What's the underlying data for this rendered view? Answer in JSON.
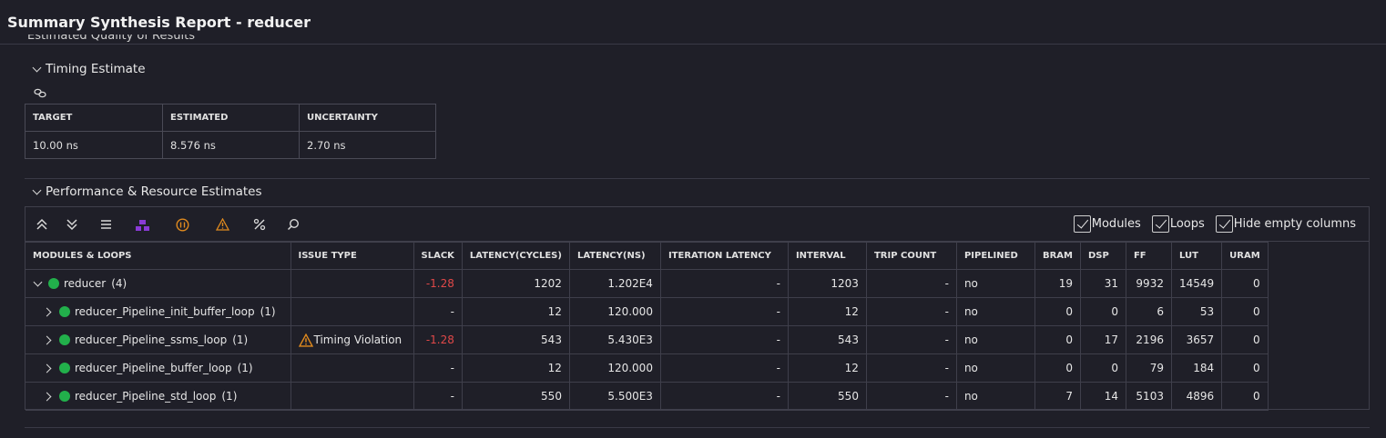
{
  "window": {
    "title": "Summary Synthesis Report - reducer"
  },
  "clipped_section": {
    "title": "Estimated Quality of Results"
  },
  "timing": {
    "title": "Timing Estimate",
    "headers": [
      "TARGET",
      "ESTIMATED",
      "UNCERTAINTY"
    ],
    "values": [
      "10.00 ns",
      "8.576 ns",
      "2.70 ns"
    ]
  },
  "perf": {
    "title": "Performance & Resource Estimates",
    "toolbar": {
      "icons": [
        "collapse-all-icon",
        "expand-all-icon",
        "list-icon",
        "module-hierarchy-icon",
        "pipeline-icon",
        "warning-icon",
        "percent-icon",
        "search-icon"
      ],
      "checkboxes": [
        {
          "label": "Modules",
          "checked": true
        },
        {
          "label": "Loops",
          "checked": true
        },
        {
          "label": "Hide empty columns",
          "checked": true
        }
      ]
    },
    "headers": [
      "MODULES & LOOPS",
      "ISSUE TYPE",
      "SLACK",
      "LATENCY(CYCLES)",
      "LATENCY(NS)",
      "ITERATION LATENCY",
      "INTERVAL",
      "TRIP COUNT",
      "PIPELINED",
      "BRAM",
      "DSP",
      "FF",
      "LUT",
      "URAM"
    ],
    "rows": [
      {
        "name": "reducer",
        "count": "(4)",
        "issue": "",
        "slack": "-1.28",
        "lat_cycles": "1202",
        "lat_ns": "1.202E4",
        "iter_lat": "-",
        "interval": "1203",
        "trip": "-",
        "pipelined": "no",
        "bram": "19",
        "dsp": "31",
        "ff": "9932",
        "lut": "14549",
        "uram": "0"
      },
      {
        "name": "reducer_Pipeline_init_buffer_loop",
        "count": "(1)",
        "issue": "",
        "slack": "-",
        "lat_cycles": "12",
        "lat_ns": "120.000",
        "iter_lat": "-",
        "interval": "12",
        "trip": "-",
        "pipelined": "no",
        "bram": "0",
        "dsp": "0",
        "ff": "6",
        "lut": "53",
        "uram": "0"
      },
      {
        "name": "reducer_Pipeline_ssms_loop",
        "count": "(1)",
        "issue": "Timing Violation",
        "slack": "-1.28",
        "lat_cycles": "543",
        "lat_ns": "5.430E3",
        "iter_lat": "-",
        "interval": "543",
        "trip": "-",
        "pipelined": "no",
        "bram": "0",
        "dsp": "17",
        "ff": "2196",
        "lut": "3657",
        "uram": "0"
      },
      {
        "name": "reducer_Pipeline_buffer_loop",
        "count": "(1)",
        "issue": "",
        "slack": "-",
        "lat_cycles": "12",
        "lat_ns": "120.000",
        "iter_lat": "-",
        "interval": "12",
        "trip": "-",
        "pipelined": "no",
        "bram": "0",
        "dsp": "0",
        "ff": "79",
        "lut": "184",
        "uram": "0"
      },
      {
        "name": "reducer_Pipeline_std_loop",
        "count": "(1)",
        "issue": "",
        "slack": "-",
        "lat_cycles": "550",
        "lat_ns": "5.500E3",
        "iter_lat": "-",
        "interval": "550",
        "trip": "-",
        "pipelined": "no",
        "bram": "7",
        "dsp": "14",
        "ff": "5103",
        "lut": "4896",
        "uram": "0"
      }
    ]
  },
  "colors": {
    "background": "#1f1f28",
    "negative": "#e04848",
    "status_ok": "#22b04b",
    "accent_purple": "#8a3ad6",
    "accent_orange": "#e08a1e"
  }
}
